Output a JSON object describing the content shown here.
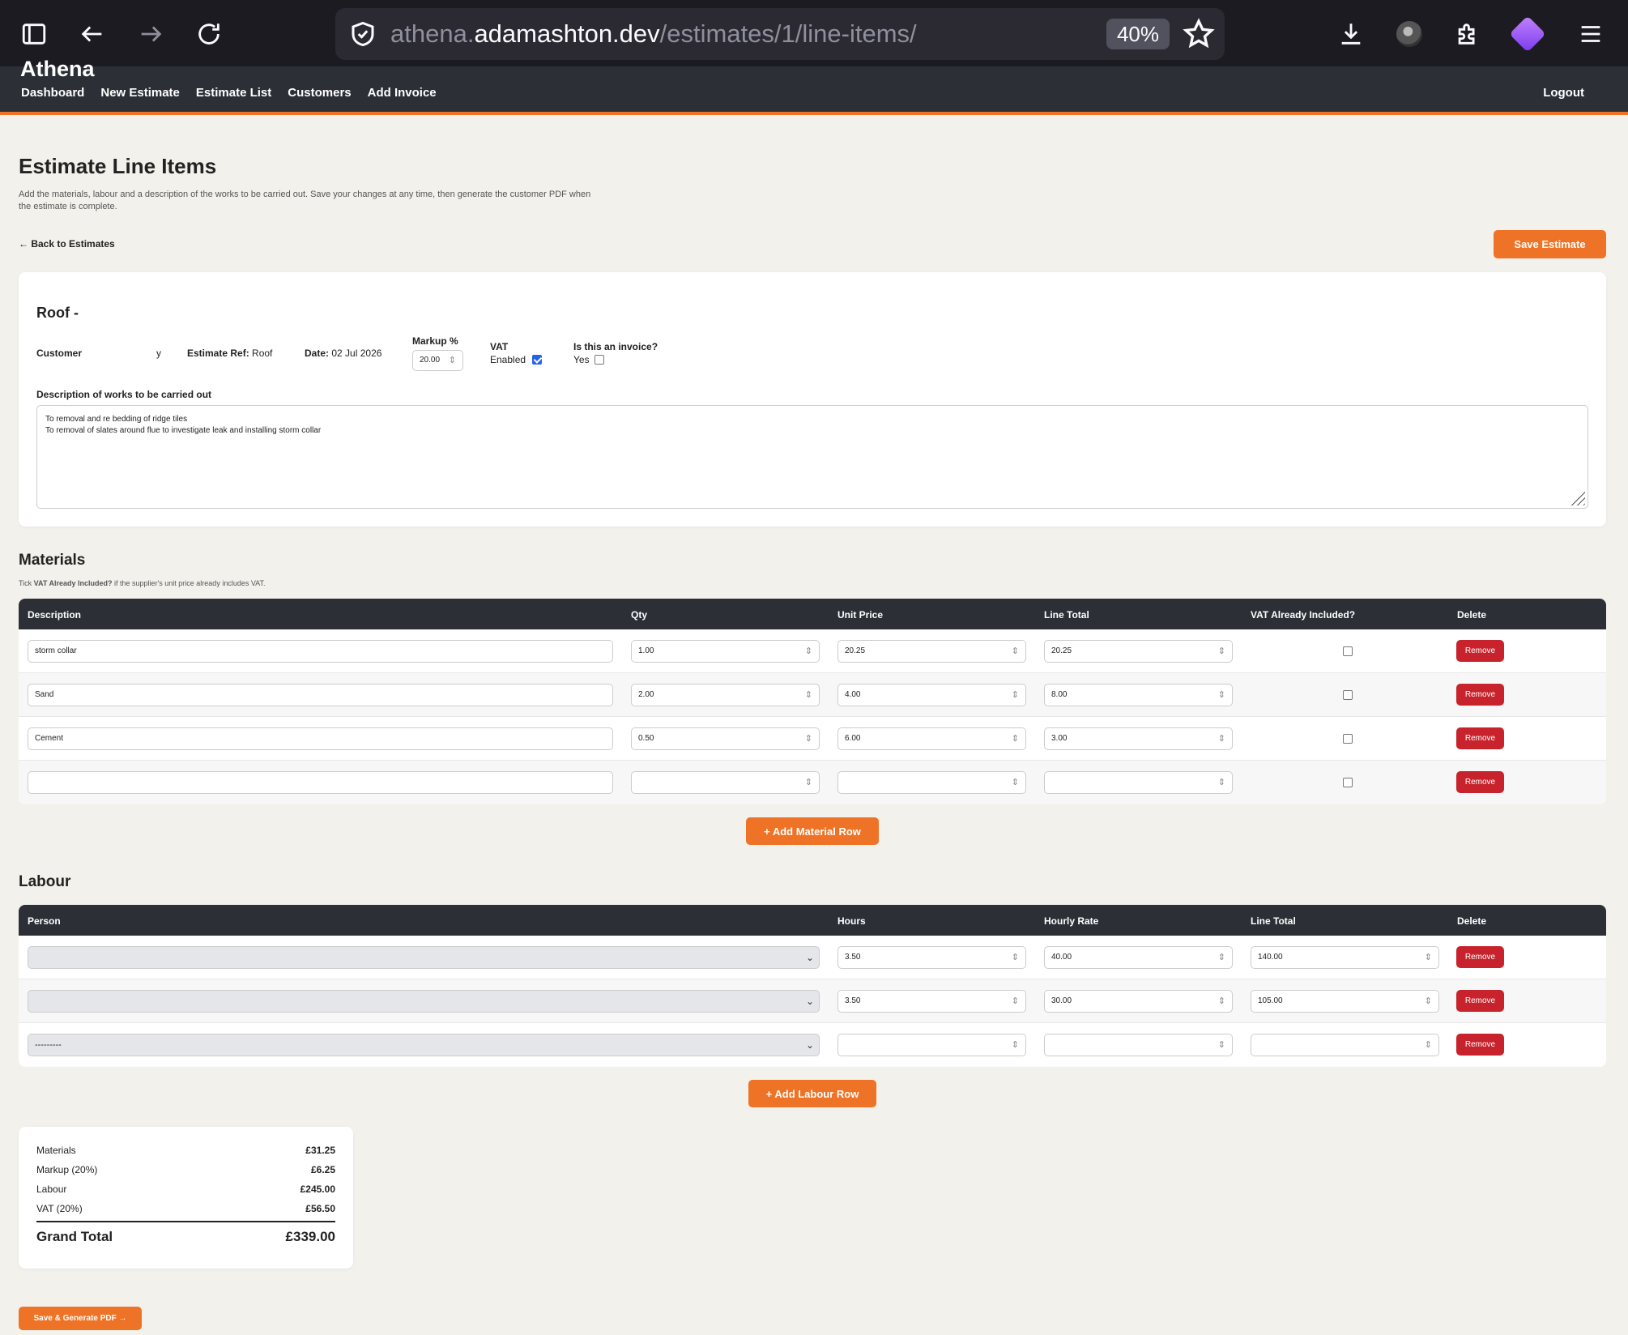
{
  "browser": {
    "url_host_prefix": "athena.",
    "url_host": "adamashton.dev",
    "url_path": "/estimates/1/line-items/",
    "zoom": "40%"
  },
  "nav": {
    "brand": "Athena",
    "links": [
      "Dashboard",
      "New Estimate",
      "Estimate List",
      "Customers",
      "Add Invoice"
    ],
    "logout": "Logout"
  },
  "page": {
    "title": "Estimate Line Items",
    "intro": "Add the materials, labour and a description of the works to be carried out. Save your changes at any time, then generate the customer PDF when the estimate is complete.",
    "back_link": "← Back to Estimates",
    "save_button": "Save Estimate"
  },
  "estimate": {
    "title": "Roof -",
    "customer_label": "Customer",
    "customer_value": "y",
    "ref_label": "Estimate Ref:",
    "ref_value": "Roof",
    "date_label": "Date:",
    "date_value": "02 Jul 2026",
    "markup_label": "Markup %",
    "markup_value": "20.00",
    "vat_label": "VAT",
    "vat_enabled_label": "Enabled",
    "vat_enabled": true,
    "invoice_label": "Is this an invoice?",
    "invoice_yes_label": "Yes",
    "is_invoice": false,
    "description_label": "Description of works to be carried out",
    "description_lines": [
      "To removal and re bedding of ridge tiles",
      "To removal of slates around flue to investigate leak and installing storm collar"
    ]
  },
  "materials": {
    "heading": "Materials",
    "note_prefix": "Tick ",
    "note_bold": "VAT Already Included?",
    "note_suffix": " if the supplier's unit price already includes VAT.",
    "columns": [
      "Description",
      "Qty",
      "Unit Price",
      "Line Total",
      "VAT Already Included?",
      "Delete"
    ],
    "rows": [
      {
        "description": "storm collar",
        "qty": "1.00",
        "unit_price": "20.25",
        "line_total": "20.25",
        "vat_included": false
      },
      {
        "description": "Sand",
        "qty": "2.00",
        "unit_price": "4.00",
        "line_total": "8.00",
        "vat_included": false
      },
      {
        "description": "Cement",
        "qty": "0.50",
        "unit_price": "6.00",
        "line_total": "3.00",
        "vat_included": false
      },
      {
        "description": "",
        "qty": "",
        "unit_price": "",
        "line_total": "",
        "vat_included": false
      }
    ],
    "remove_label": "Remove",
    "add_button": "+ Add Material Row"
  },
  "labour": {
    "heading": "Labour",
    "columns": [
      "Person",
      "Hours",
      "Hourly Rate",
      "Line Total",
      "Delete"
    ],
    "rows": [
      {
        "person": "",
        "hours": "3.50",
        "rate": "40.00",
        "line_total": "140.00"
      },
      {
        "person": "",
        "hours": "3.50",
        "rate": "30.00",
        "line_total": "105.00"
      },
      {
        "person": "---------",
        "hours": "",
        "rate": "",
        "line_total": ""
      }
    ],
    "remove_label": "Remove",
    "add_button": "+ Add Labour Row"
  },
  "totals": {
    "lines": [
      {
        "label": "Materials",
        "value": "£31.25"
      },
      {
        "label": "Markup (20%)",
        "value": "£6.25"
      },
      {
        "label": "Labour",
        "value": "£245.00"
      },
      {
        "label": "VAT (20%)",
        "value": "£56.50"
      }
    ],
    "grand_label": "Grand Total",
    "grand_value": "£339.00"
  },
  "pdf_button": "Save & Generate PDF →",
  "colors": {
    "accent": "#ee7326",
    "nav_bg": "#2c3036",
    "danger": "#c8232c",
    "page_bg": "#f3f1ec"
  },
  "icons": {
    "sidebar": "sidebar-icon",
    "back": "back-arrow-icon",
    "forward": "forward-arrow-icon",
    "reload": "reload-icon",
    "shield": "shield-icon",
    "star": "star-icon",
    "download": "download-icon",
    "extensions": "puzzle-icon",
    "menu": "hamburger-menu-icon"
  }
}
